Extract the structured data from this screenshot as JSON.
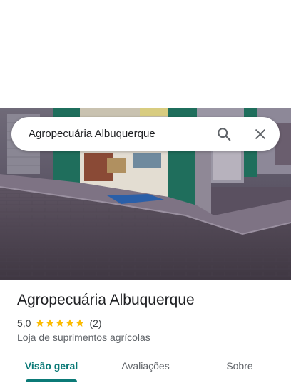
{
  "search": {
    "query": "Agropecuária Albuquerque",
    "search_icon": "search-icon",
    "close_icon": "close-icon"
  },
  "place": {
    "name": "Agropecuária Albuquerque",
    "rating_value": "5,0",
    "rating_stars": 5,
    "review_count": "(2)",
    "category": "Loja de suprimentos agrícolas"
  },
  "tabs": [
    {
      "label": "Visão geral",
      "active": true
    },
    {
      "label": "Avaliações",
      "active": false
    },
    {
      "label": "Sobre",
      "active": false
    }
  ],
  "colors": {
    "accent": "#0b7a77",
    "star": "#fbbc04"
  }
}
